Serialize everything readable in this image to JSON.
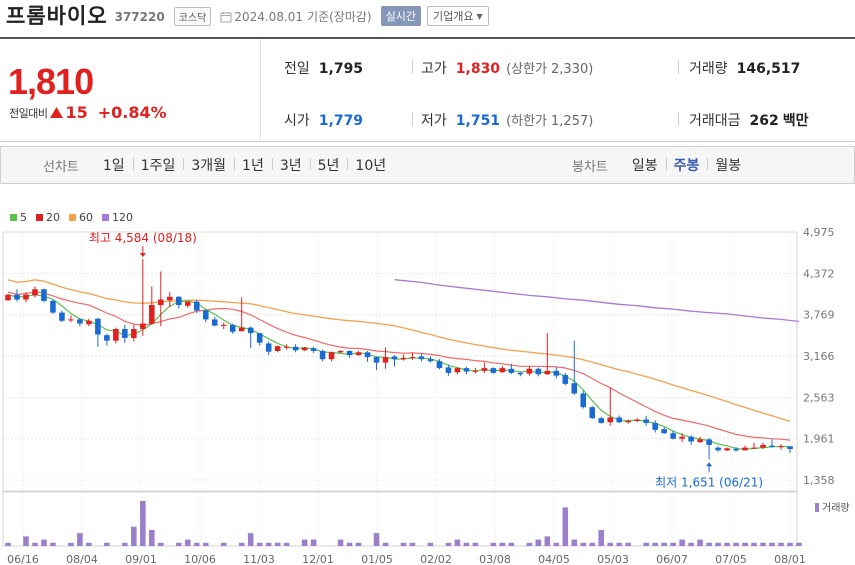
{
  "header": {
    "name": "프롬바이오",
    "code": "377220",
    "market": "코스닥",
    "date": "2024.08.01",
    "date_suffix": "기준(장마감)",
    "realtime_label": "실시간",
    "company_label": "기업개요"
  },
  "price": {
    "current": "1,810",
    "change_label": "전일대비",
    "change_amount": "15",
    "change_percent": "+0.84%"
  },
  "stats": {
    "prev_close": {
      "label": "전일",
      "value": "1,795"
    },
    "high": {
      "label": "고가",
      "value": "1,830",
      "sub_label": "(상한가",
      "sub_value": "2,330)"
    },
    "volume": {
      "label": "거래량",
      "value": "146,517"
    },
    "open": {
      "label": "시가",
      "value": "1,779"
    },
    "low": {
      "label": "저가",
      "value": "1,751",
      "sub_label": "(하한가",
      "sub_value": "1,257)"
    },
    "amount": {
      "label": "거래대금",
      "value": "262",
      "unit": "백만"
    }
  },
  "tabs": {
    "period_label": "선차트",
    "periods": [
      "1일",
      "1주일",
      "3개월",
      "1년",
      "3년",
      "5년",
      "10년"
    ],
    "candle_label": "봉차트",
    "candles": [
      "일봉",
      "주봉",
      "월봉"
    ],
    "active_candle": "주봉"
  },
  "colors": {
    "up": "#e0211f",
    "down": "#1a6ad1",
    "ma5": "#5ac14f",
    "ma20": "#f06a6a",
    "ma60": "#f5a14b",
    "ma120": "#a57ad8",
    "volume": "#9b7fcb"
  },
  "chart_data": {
    "type": "candlestick",
    "legend": [
      {
        "name": "5",
        "color": "#5ac14f"
      },
      {
        "name": "20",
        "color": "#e0211f"
      },
      {
        "name": "60",
        "color": "#f5a14b"
      },
      {
        "name": "120",
        "color": "#a57ad8"
      }
    ],
    "y_ticks": [
      "4,975",
      "4,372",
      "3,769",
      "3,166",
      "2,563",
      "1,961",
      "1,358"
    ],
    "y_tick_values": [
      4975,
      4372,
      3769,
      3166,
      2563,
      1961,
      1358
    ],
    "x_ticks": [
      "06/16",
      "08/04",
      "09/01",
      "10/06",
      "11/03",
      "12/01",
      "01/05",
      "02/02",
      "03/08",
      "04/05",
      "05/03",
      "06/07",
      "07/05",
      "08/01"
    ],
    "annotations": {
      "max_label": "최고 4,584 (08/18)",
      "min_label": "최저 1,651 (06/21)"
    },
    "volume_label": "거래량",
    "candles": [
      [
        3980,
        4060,
        4070,
        3970
      ],
      [
        4060,
        3990,
        4140,
        3960
      ],
      [
        3990,
        4060,
        4100,
        3950
      ],
      [
        4050,
        4140,
        4180,
        4020
      ],
      [
        4140,
        3970,
        4150,
        3950
      ],
      [
        3970,
        3800,
        3990,
        3780
      ],
      [
        3800,
        3680,
        3830,
        3660
      ],
      [
        3690,
        3700,
        3760,
        3660
      ],
      [
        3700,
        3640,
        3720,
        3600
      ],
      [
        3630,
        3680,
        3710,
        3600
      ],
      [
        3710,
        3480,
        3720,
        3300
      ],
      [
        3470,
        3390,
        3490,
        3320
      ],
      [
        3390,
        3560,
        3580,
        3350
      ],
      [
        3560,
        3430,
        3620,
        3360
      ],
      [
        3430,
        3560,
        3620,
        3380
      ],
      [
        3560,
        3640,
        4580,
        3460
      ],
      [
        3640,
        3910,
        4180,
        3620
      ],
      [
        3910,
        3990,
        4400,
        3600
      ],
      [
        3980,
        4030,
        4100,
        3880
      ],
      [
        4030,
        3910,
        4040,
        3860
      ],
      [
        3900,
        3960,
        3960,
        3870
      ],
      [
        3960,
        3830,
        3980,
        3790
      ],
      [
        3830,
        3700,
        3840,
        3660
      ],
      [
        3700,
        3610,
        3740,
        3600
      ],
      [
        3610,
        3620,
        3650,
        3560
      ],
      [
        3620,
        3520,
        3640,
        3490
      ],
      [
        3530,
        3580,
        4020,
        3520
      ],
      [
        3580,
        3500,
        3600,
        3280
      ],
      [
        3500,
        3360,
        3500,
        3320
      ],
      [
        3350,
        3230,
        3380,
        3180
      ],
      [
        3240,
        3310,
        3320,
        3220
      ],
      [
        3300,
        3300,
        3340,
        3260
      ],
      [
        3300,
        3250,
        3340,
        3220
      ],
      [
        3250,
        3290,
        3300,
        3240
      ],
      [
        3280,
        3240,
        3300,
        3210
      ],
      [
        3240,
        3120,
        3260,
        3090
      ],
      [
        3120,
        3220,
        3230,
        3090
      ],
      [
        3220,
        3240,
        3250,
        3210
      ],
      [
        3240,
        3180,
        3250,
        3140
      ],
      [
        3180,
        3220,
        3240,
        3170
      ],
      [
        3220,
        3150,
        3240,
        3080
      ],
      [
        3150,
        3070,
        3160,
        2960
      ],
      [
        3070,
        3150,
        3290,
        2980
      ],
      [
        3160,
        3120,
        3180,
        3010
      ],
      [
        3120,
        3140,
        3190,
        3100
      ],
      [
        3140,
        3150,
        3210,
        3110
      ],
      [
        3160,
        3120,
        3200,
        3090
      ],
      [
        3120,
        3090,
        3160,
        3070
      ],
      [
        3090,
        2990,
        3120,
        2970
      ],
      [
        3000,
        2920,
        3040,
        2880
      ],
      [
        2930,
        2990,
        3000,
        2900
      ],
      [
        2990,
        2940,
        3010,
        2900
      ],
      [
        2940,
        2950,
        2990,
        2910
      ],
      [
        2950,
        2990,
        3070,
        2920
      ],
      [
        2990,
        2920,
        3000,
        2910
      ],
      [
        2930,
        2990,
        3020,
        2920
      ],
      [
        2980,
        2920,
        3050,
        2900
      ],
      [
        2920,
        2900,
        2940,
        2870
      ],
      [
        2910,
        2980,
        3020,
        2880
      ],
      [
        2980,
        2900,
        3000,
        2870
      ],
      [
        2900,
        2950,
        3500,
        2890
      ],
      [
        2950,
        2880,
        3010,
        2840
      ],
      [
        2890,
        2760,
        2920,
        2740
      ],
      [
        2770,
        2620,
        3390,
        2600
      ],
      [
        2620,
        2420,
        2660,
        2400
      ],
      [
        2420,
        2260,
        2440,
        2250
      ],
      [
        2260,
        2190,
        2280,
        2180
      ],
      [
        2200,
        2270,
        2700,
        2150
      ],
      [
        2270,
        2200,
        2300,
        2190
      ],
      [
        2200,
        2220,
        2240,
        2180
      ],
      [
        2220,
        2240,
        2260,
        2200
      ],
      [
        2240,
        2190,
        2290,
        2150
      ],
      [
        2190,
        2090,
        2230,
        2050
      ],
      [
        2100,
        2040,
        2130,
        2030
      ],
      [
        2040,
        1960,
        2080,
        1950
      ],
      [
        1960,
        1990,
        2040,
        1910
      ],
      [
        1990,
        1920,
        2010,
        1870
      ],
      [
        1910,
        1950,
        1990,
        1900
      ],
      [
        1950,
        1870,
        1970,
        1660
      ],
      [
        1830,
        1790,
        1850,
        1770
      ],
      [
        1790,
        1820,
        1830,
        1780
      ],
      [
        1810,
        1790,
        1840,
        1770
      ],
      [
        1790,
        1830,
        1860,
        1790
      ],
      [
        1830,
        1830,
        1900,
        1810
      ],
      [
        1830,
        1870,
        1900,
        1810
      ],
      [
        1860,
        1840,
        1950,
        1830
      ],
      [
        1840,
        1850,
        1880,
        1800
      ],
      [
        1850,
        1810,
        1830,
        1751
      ]
    ],
    "ma120": [
      [
        43,
        4280
      ],
      [
        46,
        4240
      ],
      [
        48,
        4200
      ],
      [
        50,
        4170
      ],
      [
        52,
        4140
      ],
      [
        54,
        4110
      ],
      [
        56,
        4080
      ],
      [
        58,
        4050
      ],
      [
        60,
        4030
      ],
      [
        62,
        4000
      ],
      [
        64,
        3980
      ],
      [
        66,
        3950
      ],
      [
        68,
        3920
      ],
      [
        70,
        3900
      ],
      [
        72,
        3870
      ],
      [
        74,
        3850
      ],
      [
        76,
        3820
      ],
      [
        78,
        3800
      ],
      [
        80,
        3780
      ],
      [
        82,
        3750
      ],
      [
        84,
        3720
      ],
      [
        86,
        3700
      ],
      [
        88,
        3670
      ]
    ],
    "volumes": [
      1,
      0,
      3,
      1,
      2,
      1,
      0,
      1,
      4,
      1,
      0,
      1,
      0,
      1,
      6,
      14,
      5,
      1,
      0,
      1,
      2,
      1,
      1,
      0,
      1,
      0,
      1,
      4,
      1,
      1,
      1,
      1,
      0,
      2,
      2,
      0,
      0,
      2,
      1,
      1,
      0,
      4,
      1,
      0,
      1,
      1,
      0,
      1,
      0,
      1,
      2,
      1,
      1,
      0,
      1,
      1,
      1,
      0,
      1,
      2,
      3,
      1,
      12,
      2,
      1,
      1,
      5,
      1,
      1,
      1,
      0,
      1,
      1,
      1,
      1,
      2,
      1,
      2,
      1,
      1,
      1,
      1,
      1,
      1,
      1,
      1,
      1,
      1,
      1
    ]
  }
}
